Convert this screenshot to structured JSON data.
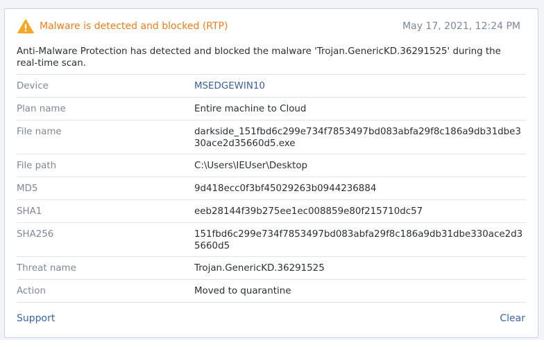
{
  "alert": {
    "title": "Malware is detected and blocked (RTP)",
    "timestamp": "May 17, 2021, 12:24 PM",
    "description": "Anti-Malware Protection has detected and blocked the malware 'Trojan.GenericKD.36291525' during the real-time scan.",
    "icon": "warning-triangle-icon",
    "title_color": "#ed7d1c",
    "icon_color": "#f5a623"
  },
  "details": [
    {
      "label": "Device",
      "value": "MSEDGEWIN10"
    },
    {
      "label": "Plan name",
      "value": "Entire machine to Cloud"
    },
    {
      "label": "File name",
      "value": "darkside_151fbd6c299e734f7853497bd083abfa29f8c186a9db31dbe330ace2d35660d5.exe"
    },
    {
      "label": "File path",
      "value": "C:\\Users\\IEUser\\Desktop"
    },
    {
      "label": "MD5",
      "value": "9d418ecc0f3bf45029263b0944236884"
    },
    {
      "label": "SHA1",
      "value": "eeb28144f39b275ee1ec008859e80f215710dc57"
    },
    {
      "label": "SHA256",
      "value": "151fbd6c299e734f7853497bd083abfa29f8c186a9db31dbe330ace2d35660d5"
    },
    {
      "label": "Threat name",
      "value": "Trojan.GenericKD.36291525"
    },
    {
      "label": "Action",
      "value": "Moved to quarantine"
    }
  ],
  "footer": {
    "support_label": "Support",
    "clear_label": "Clear"
  }
}
